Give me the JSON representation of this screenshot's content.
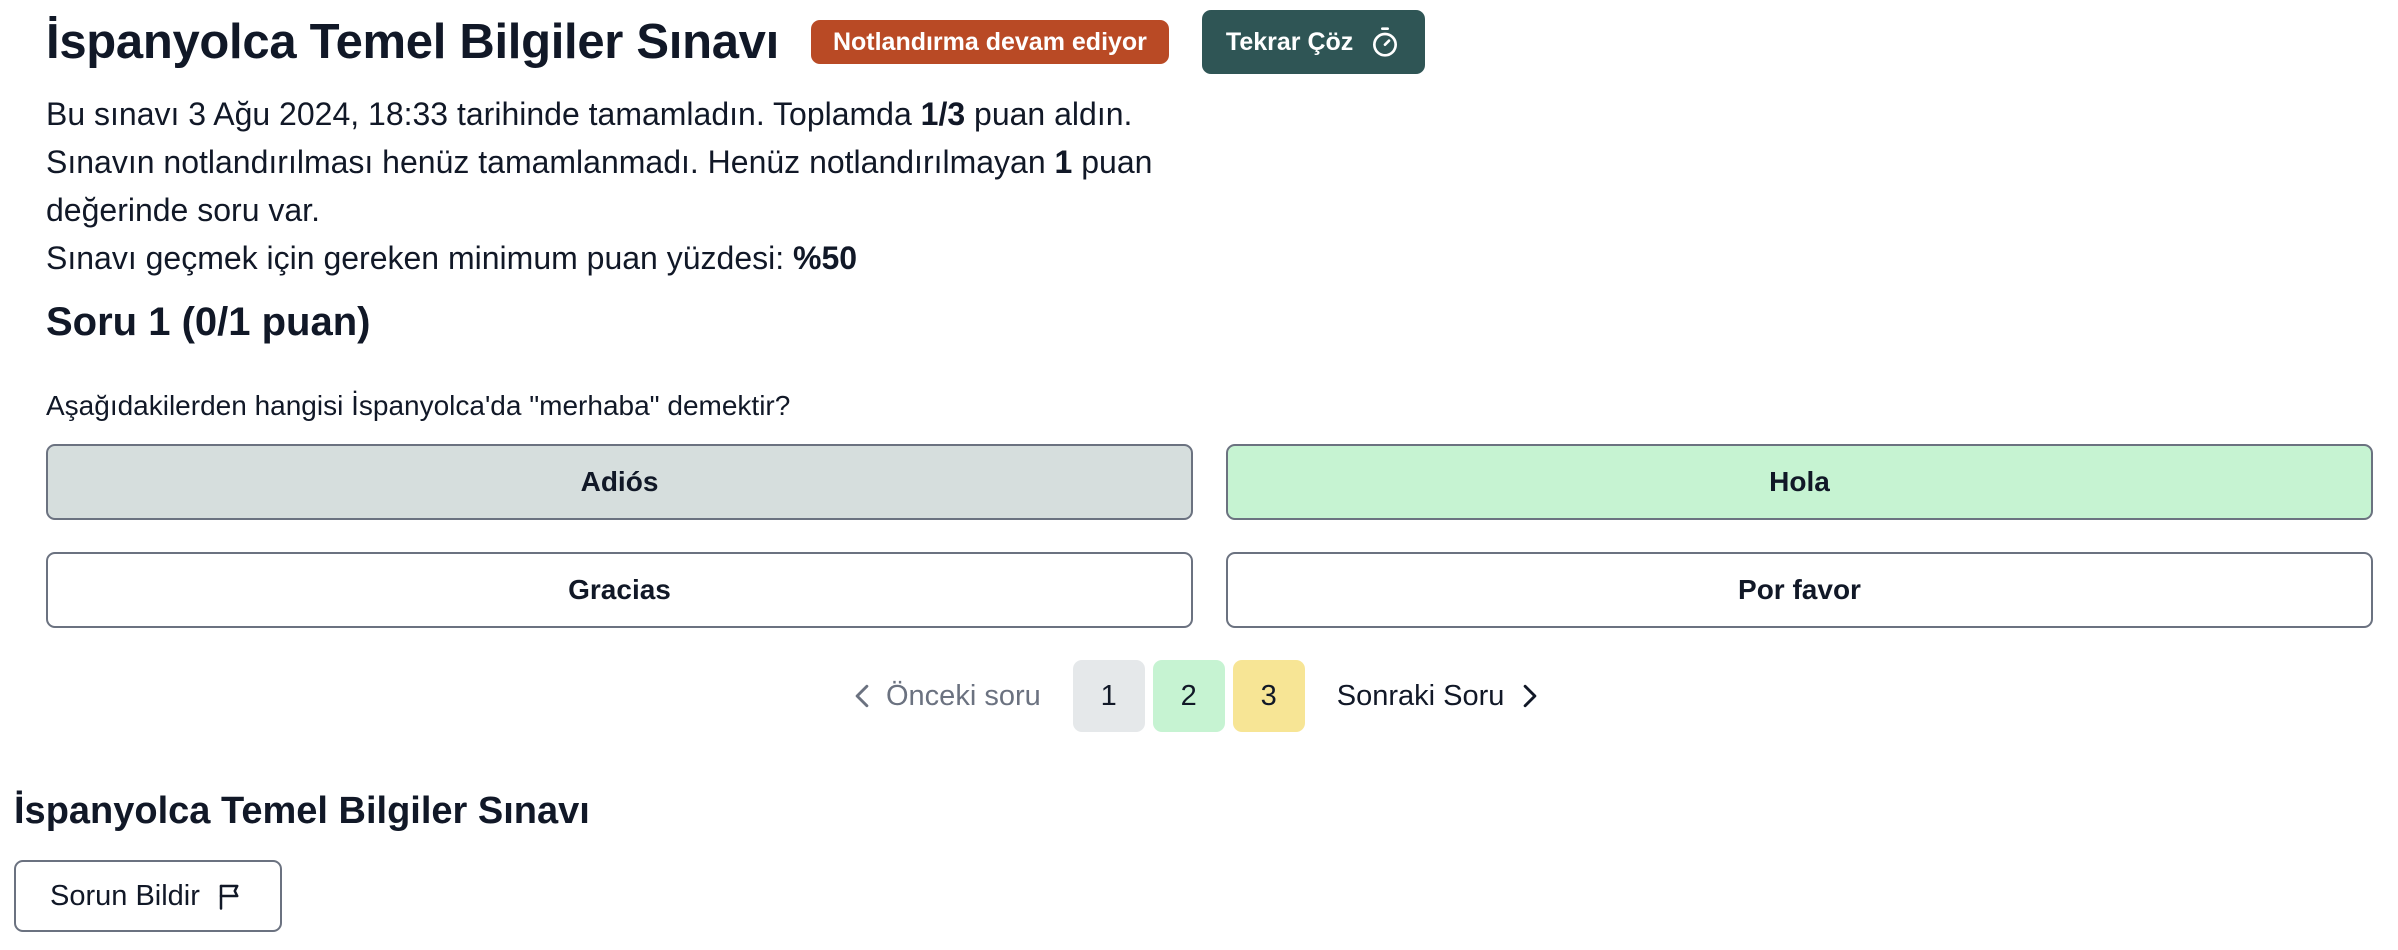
{
  "header": {
    "title": "İspanyolca Temel Bilgiler Sınavı",
    "status_badge": "Notlandırma devam ediyor",
    "retake_label": "Tekrar Çöz",
    "retake_icon": "stopwatch-icon"
  },
  "summary": {
    "line1_pre": "Bu sınavı 3 Ağu 2024, 18:33 tarihinde tamamladın. Toplamda ",
    "line1_score": "1/3",
    "line1_post": " puan aldın.",
    "line2_pre": "Sınavın notlandırılması henüz tamamlanmadı. Henüz notlandırılmayan ",
    "line2_count": "1",
    "line2_post": " puan değerinde soru var.",
    "line3_pre": "Sınavı geçmek için gereken minimum puan yüzdesi: ",
    "line3_value": "%50"
  },
  "question": {
    "title": "Soru 1 (0/1 puan)",
    "text": "Aşağıdakilerden hangisi İspanyolca'da \"merhaba\" demektir?",
    "options": [
      {
        "label": "Adiós",
        "state": "selected"
      },
      {
        "label": "Hola",
        "state": "correct"
      },
      {
        "label": "Gracias",
        "state": "plain"
      },
      {
        "label": "Por favor",
        "state": "plain"
      }
    ]
  },
  "pagination": {
    "prev_label": "Önceki soru",
    "pages": [
      "1",
      "2",
      "3"
    ],
    "next_label": "Sonraki Soru"
  },
  "footer": {
    "title": "İspanyolca Temel Bilgiler Sınavı",
    "report_label": "Sorun Bildir",
    "report_icon": "flag-icon"
  },
  "colors": {
    "badge": "#b94a25",
    "retake": "#2f5555",
    "selected": "#d6dedd",
    "correct": "#c6f3d2",
    "page3": "#f7e595"
  }
}
